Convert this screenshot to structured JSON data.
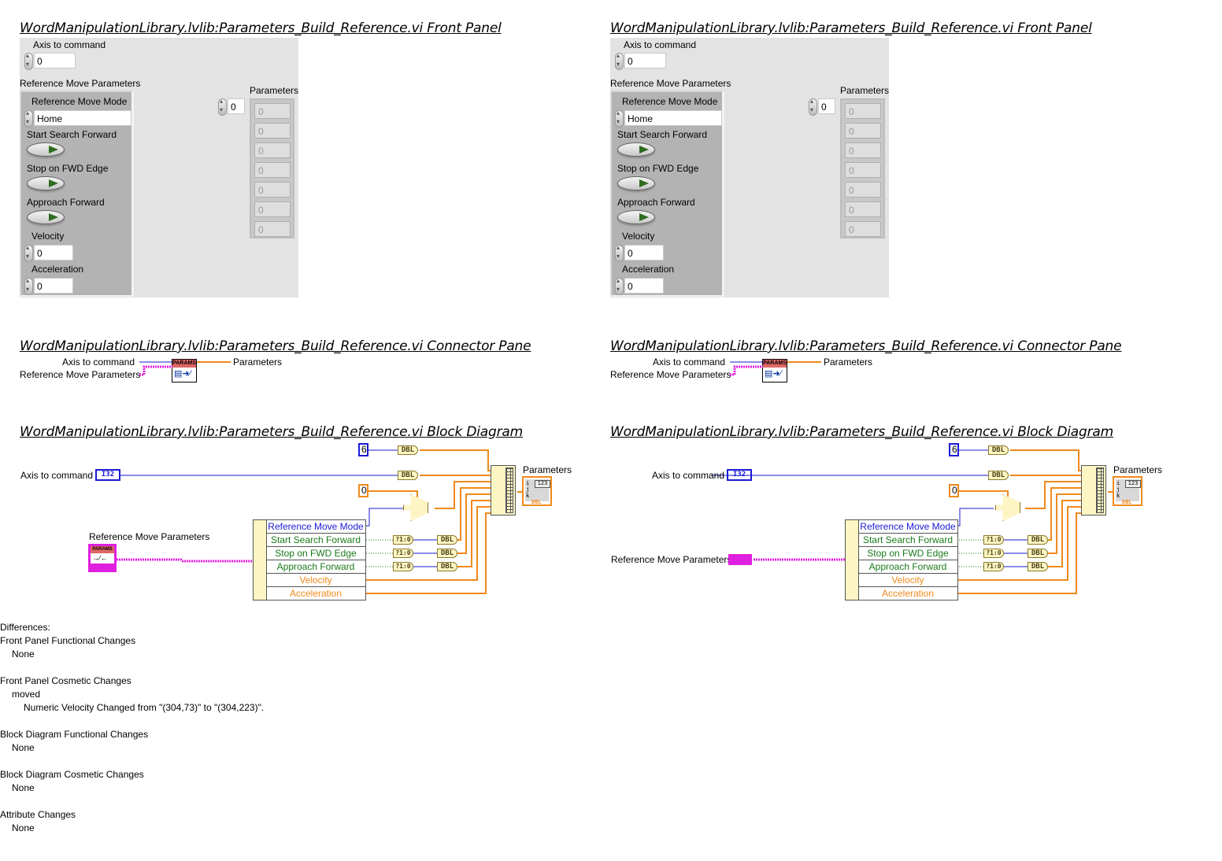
{
  "panes": [
    {
      "side": "left",
      "front_panel_title": "WordManipulationLibrary.lvlib:Parameters_Build_Reference.vi Front Panel",
      "connector_pane_title": "WordManipulationLibrary.lvlib:Parameters_Build_Reference.vi Connector Pane",
      "block_diagram_title": "WordManipulationLibrary.lvlib:Parameters_Build_Reference.vi Block Diagram"
    },
    {
      "side": "right",
      "front_panel_title": "WordManipulationLibrary.lvlib:Parameters_Build_Reference.vi Front Panel",
      "connector_pane_title": "WordManipulationLibrary.lvlib:Parameters_Build_Reference.vi Connector Pane",
      "block_diagram_title": "WordManipulationLibrary.lvlib:Parameters_Build_Reference.vi Block Diagram"
    }
  ],
  "front_panel": {
    "axis_label": "Axis to command",
    "axis_value": "0",
    "cluster_label": "Reference Move Parameters",
    "mode_label": "Reference Move Mode",
    "mode_value": "Home",
    "start_search_label": "Start Search Forward",
    "stop_edge_label": "Stop on FWD Edge",
    "approach_label": "Approach Forward",
    "velocity_label": "Velocity",
    "velocity_value": "0",
    "acceleration_label": "Acceleration",
    "acceleration_value": "0",
    "array_label": "Parameters",
    "array_index": "0",
    "array_values": [
      "0",
      "0",
      "0",
      "0",
      "0",
      "0",
      "0"
    ]
  },
  "connector_pane": {
    "input_axis": "Axis to command",
    "input_cluster": "Reference Move Parameters",
    "output": "Parameters",
    "icon_header": "PARAMS"
  },
  "block_diagram": {
    "const_six": "6",
    "const_zero": "0",
    "axis_label": "Axis to command",
    "axis_type": "I32",
    "cluster_label": "Reference Move Parameters",
    "cluster_icon_header": "PARAMS",
    "dbl": "DBL",
    "bool_to_num": "?1:0",
    "unbundle_rows": [
      {
        "label": "Reference Move Mode",
        "color": "blue"
      },
      {
        "label": "Start Search Forward",
        "color": "green"
      },
      {
        "label": "Stop on FWD Edge",
        "color": "green"
      },
      {
        "label": "Approach Forward",
        "color": "green"
      },
      {
        "label": "Velocity",
        "color": "orange"
      },
      {
        "label": "Acceleration",
        "color": "orange"
      }
    ],
    "output_label": "Parameters",
    "indicator_num": "123",
    "indicator_type": "DBL"
  },
  "differences": {
    "title": "Differences:",
    "sections": [
      {
        "heading": "Front Panel Functional Changes",
        "lines": [
          {
            "level": 1,
            "text": "None"
          }
        ]
      },
      {
        "heading": "Front Panel Cosmetic Changes",
        "lines": [
          {
            "level": 1,
            "text": "moved"
          },
          {
            "level": 2,
            "text": "Numeric Velocity Changed from \"(304,73)\" to \"(304,223)\"."
          }
        ]
      },
      {
        "heading": "Block Diagram Functional Changes",
        "lines": [
          {
            "level": 1,
            "text": "None"
          }
        ]
      },
      {
        "heading": "Block Diagram Cosmetic Changes",
        "lines": [
          {
            "level": 1,
            "text": "None"
          }
        ]
      },
      {
        "heading": "Attribute Changes",
        "lines": [
          {
            "level": 1,
            "text": "None"
          }
        ]
      }
    ]
  },
  "colors": {
    "int_wire": "#1a1ad6",
    "dbl_wire": "#f08a1c",
    "bool_wire": "#1a7a1a",
    "cluster_wire": "#e020e0"
  }
}
